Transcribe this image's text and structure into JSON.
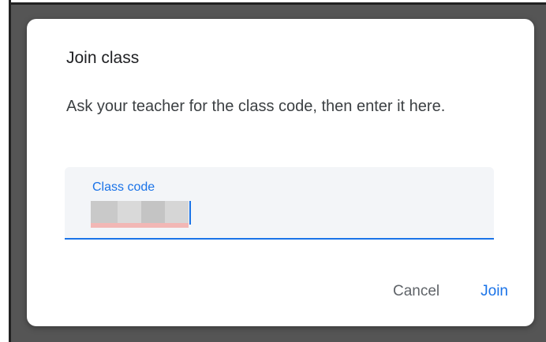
{
  "dialog": {
    "title": "Join class",
    "description": "Ask your teacher for the class code, then enter it here."
  },
  "class_code_field": {
    "label": "Class code",
    "value_state": "redacted",
    "focused": true
  },
  "actions": {
    "cancel_label": "Cancel",
    "join_label": "Join"
  },
  "colors": {
    "accent": "#1a73e8",
    "field_background": "#f3f5f8",
    "backdrop": "#555555"
  }
}
